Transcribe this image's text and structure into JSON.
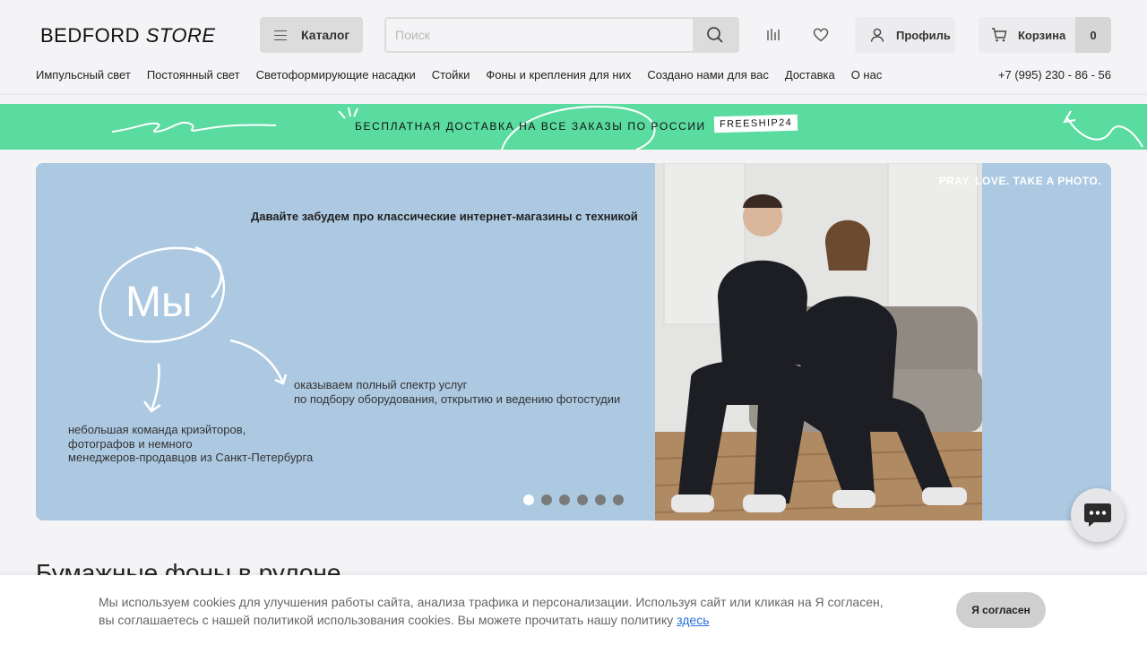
{
  "header": {
    "logo_main": "BEDFORD",
    "logo_italic": "STORE",
    "catalog_label": "Каталог",
    "search_placeholder": "Поиск",
    "profile_label": "Профиль",
    "cart_label": "Корзина",
    "cart_count": "0"
  },
  "nav": {
    "items": [
      {
        "label": "Импульсный свет"
      },
      {
        "label": "Постоянный свет"
      },
      {
        "label": "Светоформирующие насадки"
      },
      {
        "label": "Стойки"
      },
      {
        "label": "Фоны и крепления для них"
      },
      {
        "label": "Создано нами для вас"
      },
      {
        "label": "Доставка"
      },
      {
        "label": "О нас"
      }
    ],
    "phone": "+7 (995) 230 - 86 - 56"
  },
  "promo": {
    "text": "БЕСПЛАТНАЯ ДОСТАВКА НА ВСЕ ЗАКАЗЫ ПО РОССИИ",
    "code": "FREESHIP24",
    "background": "#5adba0"
  },
  "banner": {
    "heading": "Давайте забудем про классические интернет-магазины с техникой",
    "we": "Мы",
    "services_line1": "оказываем полный спектр услуг",
    "services_line2": "по подбору оборудования, открытию и ведению фотостудии",
    "team_line1": "небольшая команда криэйторов,",
    "team_line2": "фотографов и немного",
    "team_line3": "менеджеров-продавцов из Санкт-Петербурга",
    "tagline": "PRAY. LOVE. TAKE A PHOTO.",
    "slides": 6,
    "active_slide": 1,
    "background": "#adc9e2"
  },
  "section": {
    "title": "Бумажные фоны в рулоне"
  },
  "cookie": {
    "text_line1": "Мы используем cookies для улучшения работы сайта, анализа трафика и персонализации. Используя сайт или кликая на Я согласен,",
    "text_line2": "вы соглашаетесь с нашей политикой использования cookies. Вы можете прочитать нашу политику ",
    "link": "здесь",
    "button": "Я согласен"
  }
}
